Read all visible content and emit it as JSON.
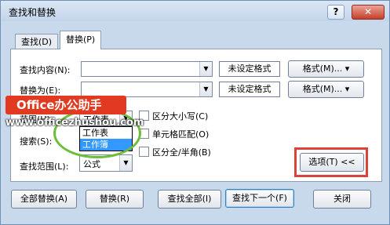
{
  "window": {
    "title": "查找和替换",
    "help_label": "?",
    "close_label": "✕"
  },
  "tabs": [
    {
      "label": "查找(D)",
      "selected": false
    },
    {
      "label": "替换(P)",
      "selected": true
    }
  ],
  "find": {
    "label": "查找内容(N):",
    "value": "",
    "format_status": "未设定格式",
    "format_button": "格式(M)... ▾"
  },
  "replace": {
    "label": "替换为(E):",
    "value": "",
    "format_status": "未设定格式",
    "format_button": "格式(M)... ▾"
  },
  "scope": {
    "label": "范围(H):",
    "value": "工作表",
    "options": [
      "工作表",
      "工作簿"
    ],
    "highlighted_option": "工作簿"
  },
  "search": {
    "label": "搜索(S):"
  },
  "look_in": {
    "label": "查找范围(L):",
    "value": "公式"
  },
  "options": {
    "match_case": {
      "label": "区分大小写(C)",
      "checked": false
    },
    "match_cell": {
      "label": "单元格匹配(O)",
      "checked": false
    },
    "match_width": {
      "label": "区分全/半角(B)",
      "checked": false
    }
  },
  "options_button": "选项(T) <<",
  "buttons": {
    "replace_all": "全部替换(A)",
    "replace": "替换(R)",
    "find_all": "查找全部(I)",
    "find_next": "查找下一个(F)",
    "close": "关闭"
  },
  "watermark": {
    "badge": "Office办公助手",
    "url": "www.officezhushou.com"
  },
  "colors": {
    "badge_red": "#e23a21",
    "circle_green": "#6bbd3a",
    "highlight_red": "#d9433a",
    "selection_blue": "#3399ff"
  }
}
